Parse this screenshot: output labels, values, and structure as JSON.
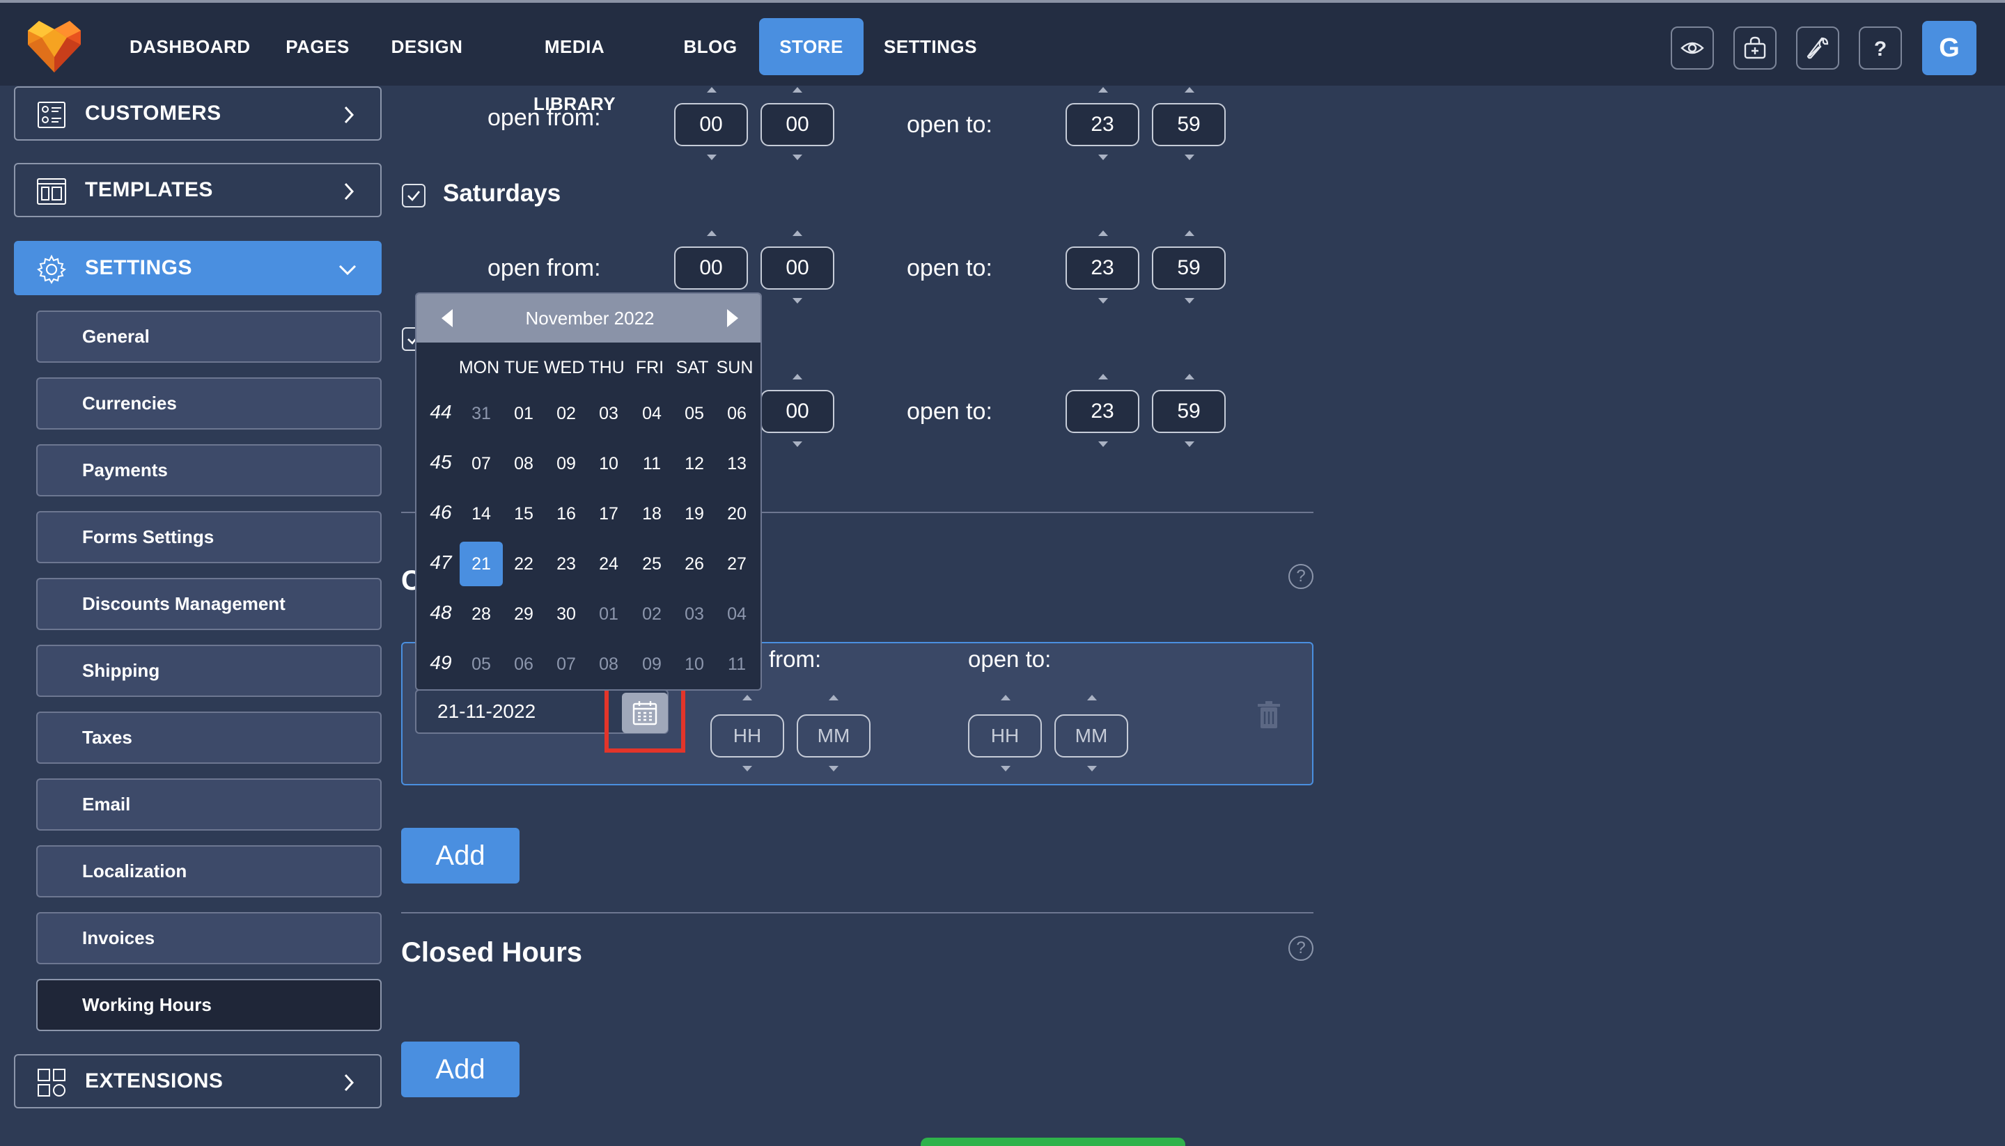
{
  "nav": {
    "items": [
      "DASHBOARD",
      "PAGES",
      "DESIGN",
      "MEDIA LIBRARY",
      "BLOG",
      "STORE",
      "SETTINGS"
    ],
    "active": "STORE",
    "avatar_letter": "G",
    "tool_icons": [
      "eye-icon",
      "bag-icon",
      "wrench-icon",
      "help-icon"
    ]
  },
  "sidebar": {
    "customers": "CUSTOMERS",
    "templates": "TEMPLATES",
    "settings": "SETTINGS",
    "extensions": "EXTENSIONS",
    "sub_items": [
      "General",
      "Currencies",
      "Payments",
      "Forms Settings",
      "Discounts Management",
      "Shipping",
      "Taxes",
      "Email",
      "Localization",
      "Invoices",
      "Working Hours"
    ],
    "active_sub": "Working Hours"
  },
  "working_hours": {
    "open_from_label": "open from:",
    "open_to_label": "open to:",
    "from_partial_label": "from:",
    "row1": {
      "from_h": "00",
      "from_m": "00",
      "to_h": "23",
      "to_m": "59"
    },
    "saturdays": {
      "label": "Saturdays",
      "from_h": "00",
      "from_m": "00",
      "to_h": "23",
      "to_m": "59"
    },
    "row3": {
      "from_m": "00",
      "to_h": "23",
      "to_m": "59"
    },
    "hh_placeholder": "HH",
    "mm_placeholder": "MM"
  },
  "special_day": {
    "date_value": "21-11-2022",
    "heading_partial": "C"
  },
  "closed_hours": {
    "title": "Closed Hours"
  },
  "buttons": {
    "add": "Add"
  },
  "calendar": {
    "month_label": "November 2022",
    "dow": [
      "MON",
      "TUE",
      "WED",
      "THU",
      "FRI",
      "SAT",
      "SUN"
    ],
    "weeks": [
      {
        "n": "44",
        "days": [
          "31",
          "01",
          "02",
          "03",
          "04",
          "05",
          "06"
        ],
        "other": [
          0
        ]
      },
      {
        "n": "45",
        "days": [
          "07",
          "08",
          "09",
          "10",
          "11",
          "12",
          "13"
        ],
        "other": []
      },
      {
        "n": "46",
        "days": [
          "14",
          "15",
          "16",
          "17",
          "18",
          "19",
          "20"
        ],
        "other": []
      },
      {
        "n": "47",
        "days": [
          "21",
          "22",
          "23",
          "24",
          "25",
          "26",
          "27"
        ],
        "other": []
      },
      {
        "n": "48",
        "days": [
          "28",
          "29",
          "30",
          "01",
          "02",
          "03",
          "04"
        ],
        "other": [
          3,
          4,
          5,
          6
        ]
      },
      {
        "n": "49",
        "days": [
          "05",
          "06",
          "07",
          "08",
          "09",
          "10",
          "11"
        ],
        "other": [
          0,
          1,
          2,
          3,
          4,
          5,
          6
        ]
      }
    ],
    "selected": "21"
  }
}
